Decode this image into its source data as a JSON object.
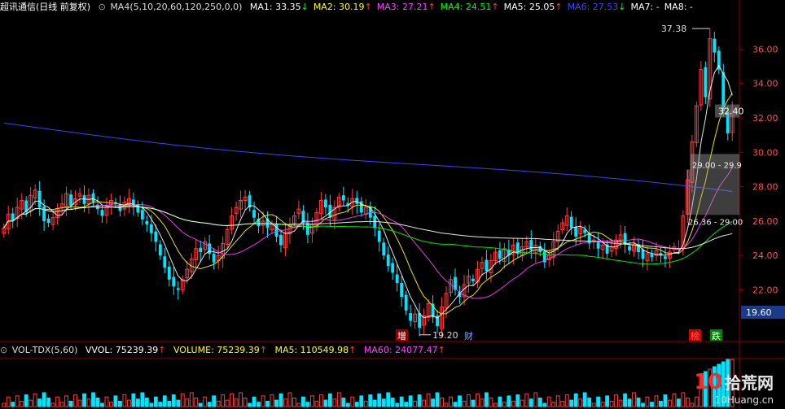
{
  "header": {
    "title": "超讯通信(日线 前复权)",
    "ma_settings": "MA4(5,10,20,60,120,250,0,0)",
    "ma": [
      {
        "label": "MA1: 33.35",
        "arrow": "↓",
        "color": "#ffffff"
      },
      {
        "label": "MA2: 30.19",
        "arrow": "↑",
        "color": "#ffff00"
      },
      {
        "label": "MA3: 27.21",
        "arrow": "↑",
        "color": "#ff40ff"
      },
      {
        "label": "MA4: 24.51",
        "arrow": "↑",
        "color": "#00ff00"
      },
      {
        "label": "MA5: 25.05",
        "arrow": "↑",
        "color": "#ffffff"
      },
      {
        "label": "MA6: 27.53",
        "arrow": "↓",
        "color": "#4040ff"
      },
      {
        "label": "MA7: -",
        "arrow": "",
        "color": "#ffffff"
      },
      {
        "label": "MA8: -",
        "arrow": "",
        "color": "#ffffff"
      }
    ]
  },
  "price_axis": {
    "ticks": [
      "36.00",
      "34.00",
      "32.00",
      "30.00",
      "28.00",
      "26.00",
      "24.00",
      "22.00"
    ],
    "current_price": "32.40",
    "low_marker": "19.60"
  },
  "annotations": {
    "high": "37.38",
    "low": "19.20",
    "range1": "29.00 - 29.9",
    "range2": "26.36 - 29.00",
    "event_zeng": "增",
    "event_cai": "财",
    "event_bang": "榜",
    "event_die": "跌"
  },
  "volume_header": {
    "indicator": "VOL-TDX(5,60)",
    "vvol": "VVOL: 75239.39",
    "vvol_arrow": "↑",
    "volume": "VOLUME: 75239.39",
    "volume_arrow": "↑",
    "ma5": "MA5: 110549.98",
    "ma5_arrow": "↑",
    "ma60": "MA60: 24077.47",
    "ma60_arrow": "↑"
  },
  "watermark": {
    "logo": "10",
    "cn": "拾荒网",
    "url": "10Huang.cn"
  },
  "colors": {
    "up": "#ff3c3c",
    "down": "#00e5ff",
    "grid": "#8b0000",
    "axis_text": "#ff5050",
    "ma5": "#ffffff",
    "ma10": "#ffff00",
    "ma20": "#ff40ff",
    "ma60": "#00ff00",
    "ma120": "#ffffff",
    "ma250": "#4040ff"
  },
  "chart_data": {
    "type": "candlestick",
    "title": "超讯通信(日线 前复权)",
    "y_range": [
      19.0,
      38.0
    ],
    "closes": [
      25.6,
      26.4,
      26.0,
      26.8,
      27.2,
      26.5,
      27.5,
      27.8,
      26.8,
      26.0,
      25.9,
      26.2,
      26.7,
      27.0,
      27.6,
      26.9,
      27.3,
      27.6,
      27.0,
      27.5,
      27.1,
      26.7,
      26.3,
      26.8,
      27.2,
      27.0,
      26.6,
      27.1,
      27.3,
      26.9,
      26.5,
      26.1,
      25.8,
      25.3,
      24.8,
      24.0,
      23.3,
      22.6,
      22.2,
      22.0,
      22.6,
      23.2,
      23.8,
      24.4,
      24.2,
      24.8,
      24.1,
      23.6,
      24.0,
      24.7,
      25.5,
      26.3,
      26.8,
      27.2,
      27.4,
      26.8,
      26.2,
      25.7,
      26.0,
      25.6,
      25.8,
      25.1,
      24.6,
      25.3,
      25.8,
      26.3,
      26.7,
      25.9,
      25.2,
      25.8,
      26.5,
      27.2,
      26.8,
      26.2,
      26.8,
      27.4,
      27.2,
      26.9,
      27.3,
      27.0,
      26.5,
      26.8,
      26.2,
      25.6,
      24.8,
      24.0,
      23.4,
      23.0,
      22.4,
      21.6,
      20.8,
      20.2,
      20.6,
      19.8,
      20.5,
      21.2,
      20.4,
      19.9,
      21.0,
      21.8,
      22.6,
      22.0,
      21.6,
      22.3,
      22.8,
      22.5,
      23.2,
      23.6,
      23.1,
      23.7,
      24.2,
      23.8,
      24.4,
      24.0,
      24.6,
      24.1,
      24.5,
      24.8,
      24.3,
      24.6,
      24.2,
      23.6,
      24.0,
      24.8,
      25.4,
      25.9,
      26.3,
      25.6,
      25.1,
      25.6,
      25.3,
      24.7,
      24.9,
      24.4,
      24.6,
      24.1,
      24.5,
      24.9,
      25.2,
      24.7,
      24.3,
      24.6,
      24.2,
      23.8,
      24.1,
      23.9,
      24.3,
      24.0,
      23.8,
      24.2,
      24.5,
      24.4,
      26.3,
      28.4,
      30.6,
      32.7,
      34.8,
      33.2,
      36.6,
      35.8,
      34.8,
      32.4,
      31.1,
      32.4
    ]
  }
}
